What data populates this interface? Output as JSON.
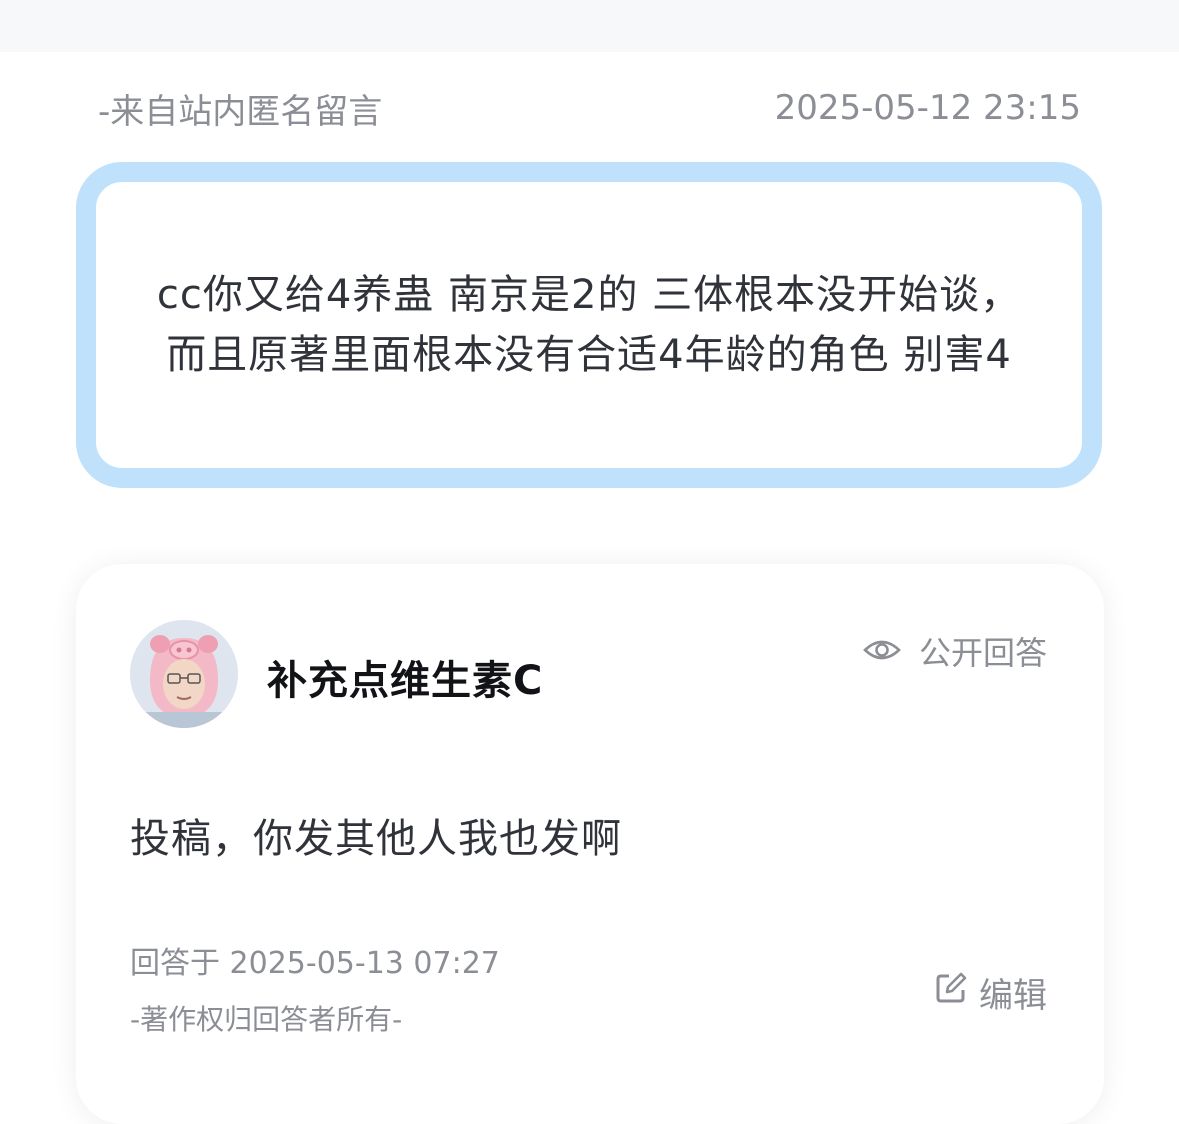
{
  "question": {
    "source": "-来自站内匿名留言",
    "timestamp": "2025-05-12 23:15",
    "text": "cc你又给4养蛊 南京是2的 三体根本没开始谈，而且原著里面根本没有合适4年龄的角色 别害4"
  },
  "answer": {
    "author_name": "补充点维生素C",
    "visibility_label": "公开回答",
    "body": "投稿，你发其他人我也发啊",
    "answered_time": "回答于 2025-05-13 07:27",
    "copyright": "-著作权归回答者所有-",
    "edit_label": "编辑"
  },
  "colors": {
    "question_border": "#bfe1fb",
    "muted_text": "#8b8e95",
    "main_text": "#30333a",
    "name_text": "#111317",
    "avatar_hat": "#f4b9c6"
  },
  "icons": {
    "visibility": "eye-icon",
    "edit": "edit-icon"
  }
}
